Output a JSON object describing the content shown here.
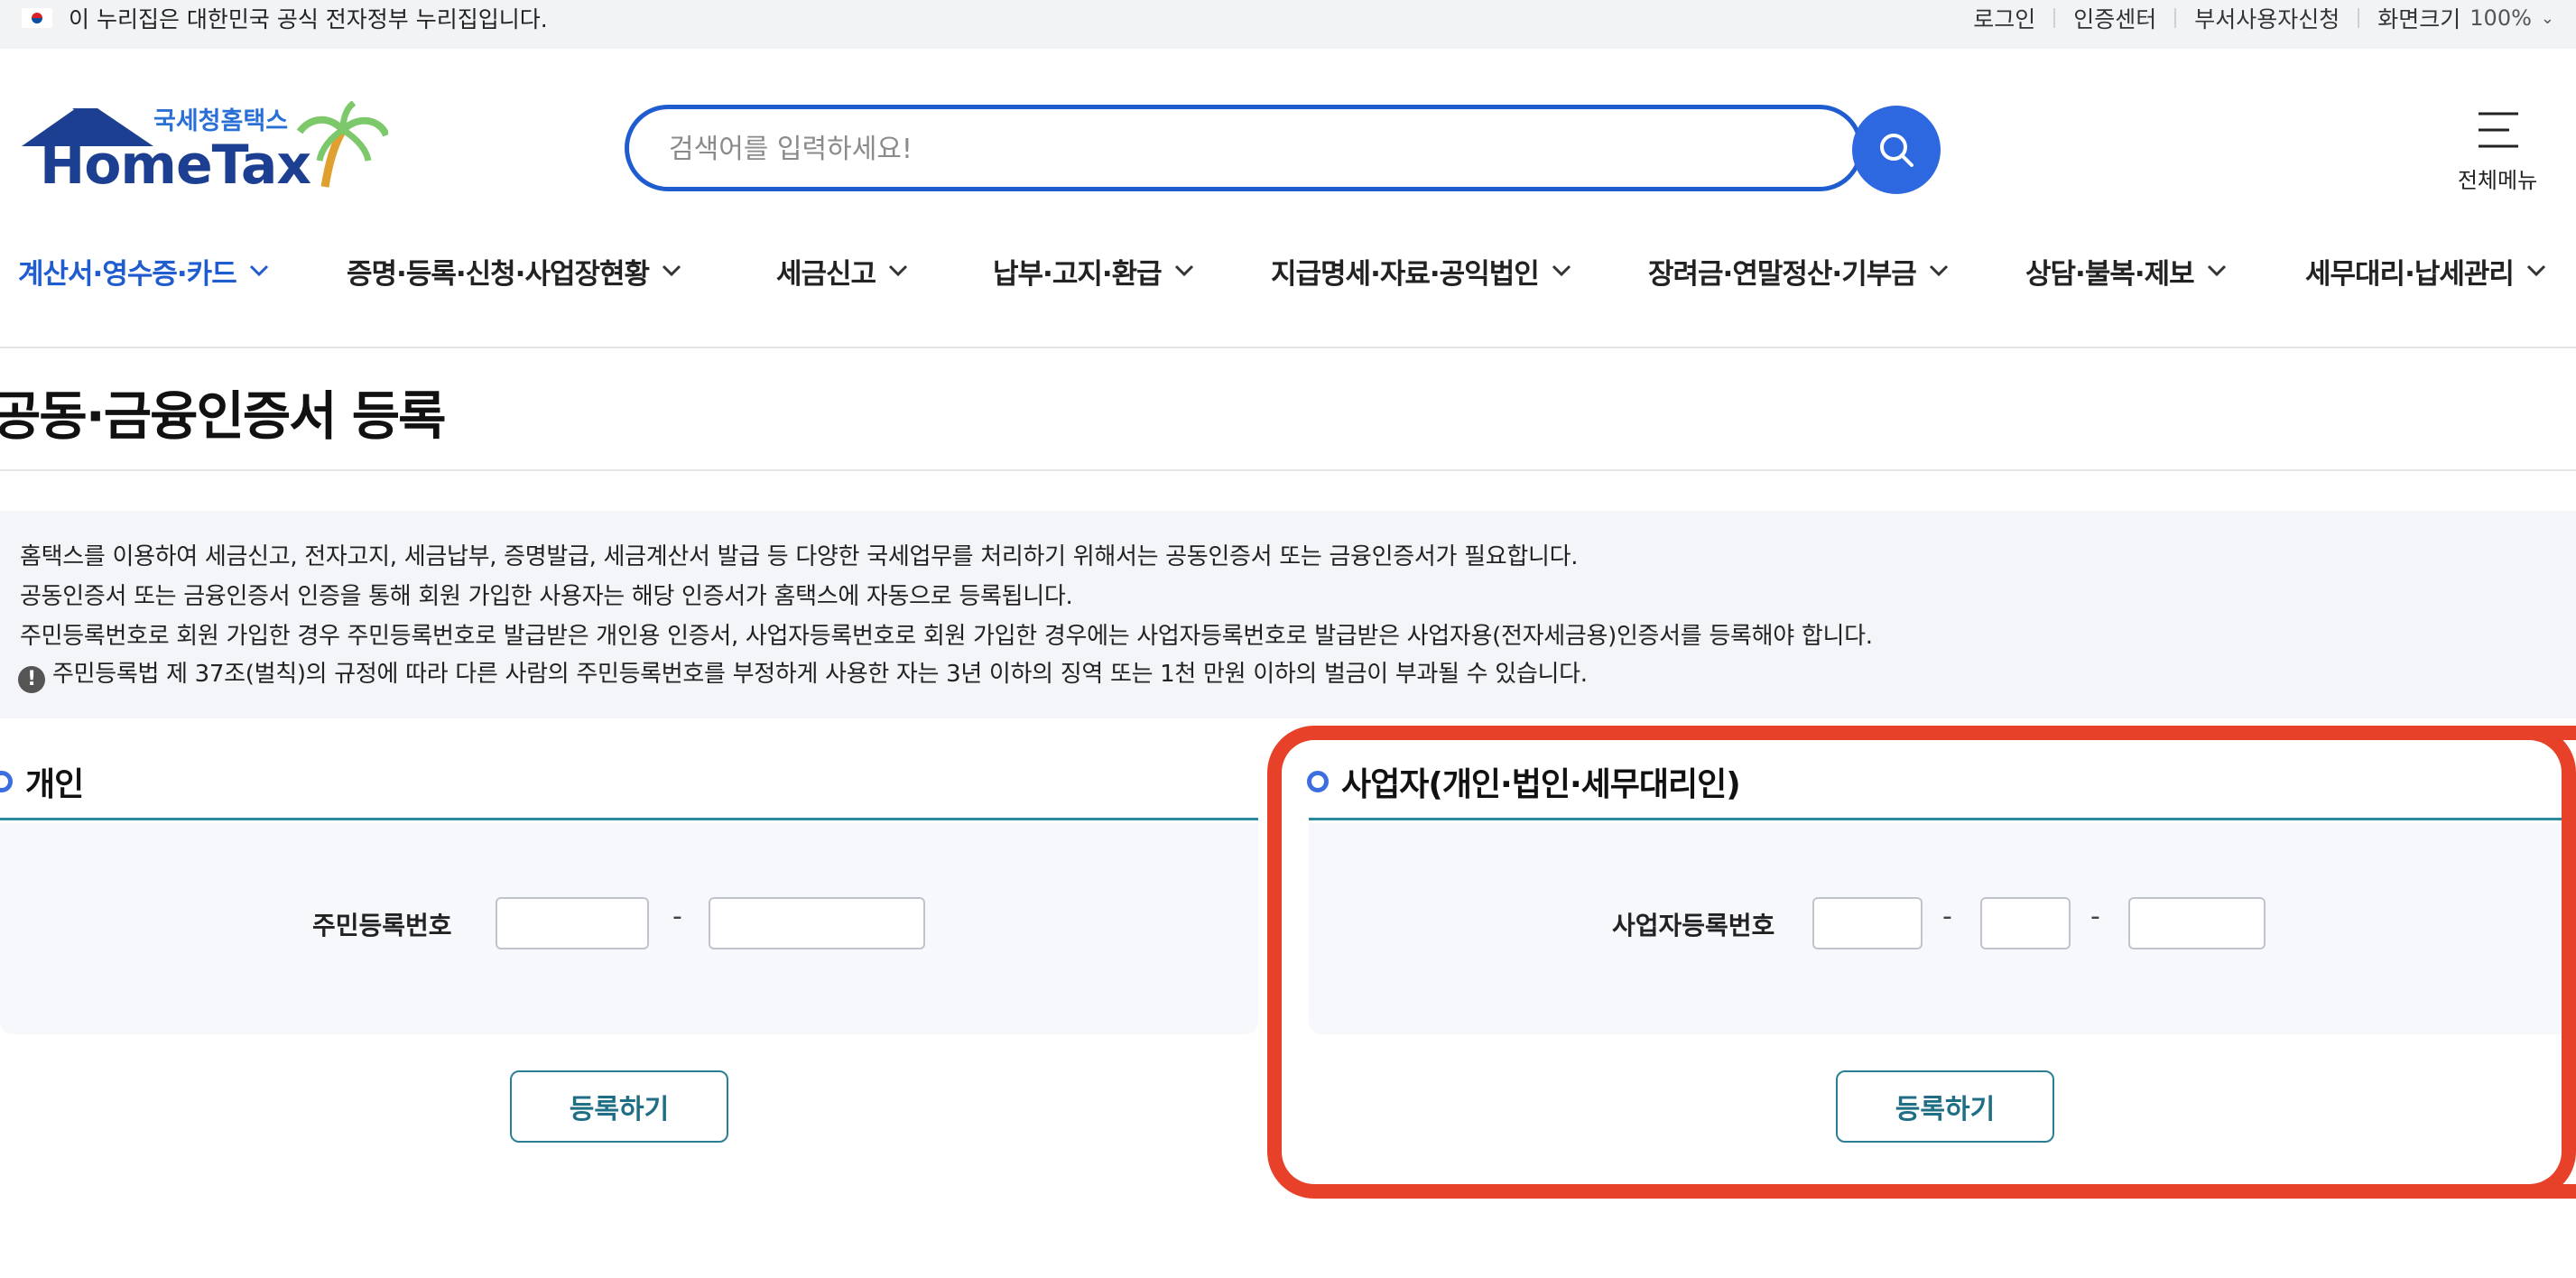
{
  "gov_banner": {
    "text": "이 누리집은 대한민국 공식 전자정부 누리집입니다.",
    "links": [
      "로그인",
      "인증센터",
      "부서사용자신청"
    ],
    "zoom_label": "화면크기",
    "zoom_value": "100%"
  },
  "logo": {
    "subtitle": "국세청홈택스",
    "name": "HomeTax"
  },
  "search": {
    "placeholder": "검색어를 입력하세요!"
  },
  "menu": {
    "label": "전체메뉴"
  },
  "gnb": [
    "계산서·영수증·카드",
    "증명·등록·신청·사업장현황",
    "세금신고",
    "납부·고지·환급",
    "지급명세·자료·공익법인",
    "장려금·연말정산·기부금",
    "상담·불복·제보",
    "세무대리·납세관리"
  ],
  "page": {
    "title": "공동·금융인증서 등록"
  },
  "info": [
    "홈택스를 이용하여 세금신고, 전자고지, 세금납부, 증명발급, 세금계산서 발급 등 다양한 국세업무를 처리하기 위해서는 공동인증서 또는 금융인증서가 필요합니다.",
    "공동인증서 또는 금융인증서 인증을 통해 회원 가입한 사용자는 해당 인증서가 홈택스에 자동으로 등록됩니다.",
    "주민등록번호로 회원 가입한 경우 주민등록번호로 발급받은 개인용 인증서, 사업자등록번호로 회원 가입한 경우에는 사업자등록번호로 발급받은 사업자용(전자세금용)인증서를 등록해야 합니다.",
    "주민등록법 제 37조(벌칙)의 규정에 따라 다른 사람의 주민등록번호를 부정하게 사용한 자는 3년 이하의 징역 또는 1천 만원 이하의 벌금이 부과될 수 있습니다."
  ],
  "individual": {
    "heading": "개인",
    "field_label": "주민등록번호",
    "dash": "-",
    "button": "등록하기"
  },
  "business": {
    "heading": "사업자(개인·법인·세무대리인)",
    "field_label": "사업자등록번호",
    "dash": "-",
    "button": "등록하기"
  },
  "colors": {
    "brand_blue": "#1f5ccf",
    "search_button": "#2e68e0",
    "section_line": "#2b8aa0",
    "highlight": "#e8412a"
  }
}
